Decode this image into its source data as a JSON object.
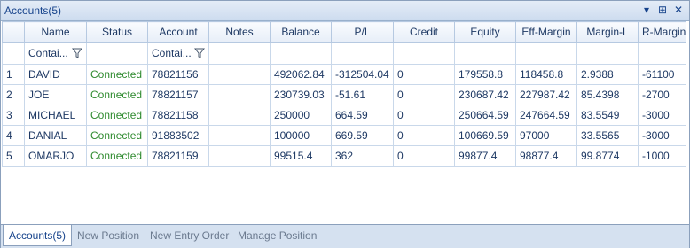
{
  "window": {
    "title": "Accounts(5)",
    "controls": [
      {
        "name": "dropdown",
        "glyph": "▾"
      },
      {
        "name": "pin",
        "glyph": "⊞"
      },
      {
        "name": "close",
        "glyph": "✕"
      }
    ]
  },
  "columns": [
    "",
    "Name",
    "Status",
    "Account",
    "Notes",
    "Balance",
    "P/L",
    "Credit",
    "Equity",
    "Eff-Margin",
    "Margin-L",
    "R-Margin"
  ],
  "filters": {
    "name": "Contai...",
    "account": "Contai..."
  },
  "rows": [
    {
      "idx": "1",
      "name": "DAVID",
      "status": "Connected",
      "account": "78821156",
      "notes": "",
      "balance": "492062.84",
      "pl": "-312504.04",
      "credit": "0",
      "equity": "179558.8",
      "eff_margin": "118458.8",
      "margin_l": "2.9388",
      "r_margin": "-61100"
    },
    {
      "idx": "2",
      "name": "JOE",
      "status": "Connected",
      "account": "78821157",
      "notes": "",
      "balance": "230739.03",
      "pl": "-51.61",
      "credit": "0",
      "equity": "230687.42",
      "eff_margin": "227987.42",
      "margin_l": "85.4398",
      "r_margin": "-2700"
    },
    {
      "idx": "3",
      "name": "MICHAEL",
      "status": "Connected",
      "account": "78821158",
      "notes": "",
      "balance": "250000",
      "pl": "664.59",
      "credit": "0",
      "equity": "250664.59",
      "eff_margin": "247664.59",
      "margin_l": "83.5549",
      "r_margin": "-3000"
    },
    {
      "idx": "4",
      "name": "DANIAL",
      "status": "Connected",
      "account": "91883502",
      "notes": "",
      "balance": "100000",
      "pl": "669.59",
      "credit": "0",
      "equity": "100669.59",
      "eff_margin": "97000",
      "margin_l": "33.5565",
      "r_margin": "-3000"
    },
    {
      "idx": "5",
      "name": "OMARJO",
      "status": "Connected",
      "account": "78821159",
      "notes": "",
      "balance": "99515.4",
      "pl": "362",
      "credit": "0",
      "equity": "99877.4",
      "eff_margin": "98877.4",
      "margin_l": "99.8774",
      "r_margin": "-1000"
    }
  ],
  "tabs": [
    {
      "label": "Accounts(5)",
      "active": true
    },
    {
      "label": "New Position",
      "active": false
    },
    {
      "label": "New Entry Order",
      "active": false
    },
    {
      "label": "Manage Position",
      "active": false
    }
  ]
}
